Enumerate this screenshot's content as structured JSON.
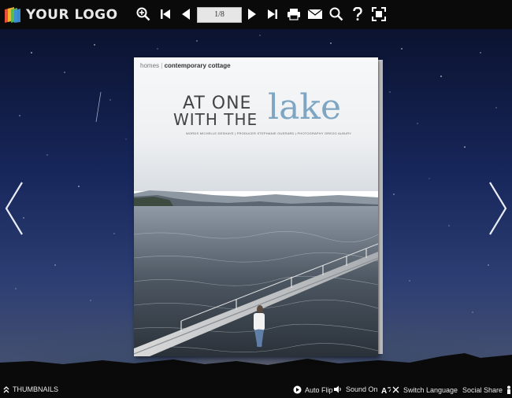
{
  "topbar": {
    "logo_text": "YOUR LOGO",
    "page_indicator": "1/8",
    "icons": [
      "zoom-in-icon",
      "first-page-icon",
      "previous-page-icon",
      "next-page-icon",
      "last-page-icon",
      "print-icon",
      "email-icon",
      "search-icon",
      "help-icon",
      "fullscreen-icon"
    ]
  },
  "book": {
    "section": "homes",
    "subsection": "contemporary cottage",
    "headline_line1": "AT ONE",
    "headline_line2": "WITH THE",
    "headline_accent": "lake",
    "credits": "WORDS MICHELLE DESHAYE  |  PRODUCER STEPHANIE GUERARD  |  PHOTOGRAPHY GREGG ALBURY",
    "accent_color": "#7ea6c3"
  },
  "bottombar": {
    "thumbnails": "THUMBNAILS",
    "auto_flip": "Auto Flip",
    "sound_on": "Sound On",
    "switch_language": "Switch Language",
    "social_share": "Social Share"
  }
}
